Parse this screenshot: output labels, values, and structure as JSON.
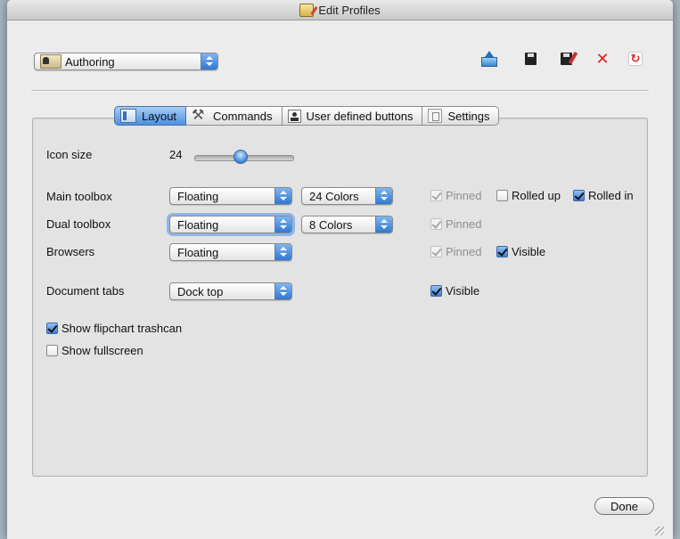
{
  "window": {
    "title": "Edit Profiles"
  },
  "profile": {
    "selected": "Authoring"
  },
  "toolbar": {
    "icons": [
      "export-icon",
      "save-icon",
      "save-as-icon",
      "delete-icon",
      "reload-icon"
    ],
    "delete_glyph": "✕",
    "reload_glyph": "↻"
  },
  "tabs": [
    {
      "label": "Layout",
      "icon": "layout-icon",
      "active": true
    },
    {
      "label": "Commands",
      "icon": "tools-icon",
      "active": false
    },
    {
      "label": "User defined buttons",
      "icon": "user-icon",
      "active": false
    },
    {
      "label": "Settings",
      "icon": "settings-icon",
      "active": false
    }
  ],
  "layout": {
    "icon_size": {
      "label": "Icon size",
      "value": "24"
    },
    "main_toolbox": {
      "label": "Main toolbox",
      "mode": "Floating",
      "colors": "24 Colors",
      "pinned": {
        "label": "Pinned",
        "checked": true,
        "enabled": false
      },
      "rolled_up": {
        "label": "Rolled up",
        "checked": false,
        "enabled": true
      },
      "rolled_in": {
        "label": "Rolled in",
        "checked": true,
        "enabled": true
      }
    },
    "dual_toolbox": {
      "label": "Dual toolbox",
      "mode": "Floating",
      "colors": "8 Colors",
      "pinned": {
        "label": "Pinned",
        "checked": true,
        "enabled": false
      }
    },
    "browsers": {
      "label": "Browsers",
      "mode": "Floating",
      "pinned": {
        "label": "Pinned",
        "checked": true,
        "enabled": false
      },
      "visible": {
        "label": "Visible",
        "checked": true,
        "enabled": true
      }
    },
    "document_tabs": {
      "label": "Document tabs",
      "position": "Dock top",
      "visible": {
        "label": "Visible",
        "checked": true,
        "enabled": true
      }
    },
    "show_flipchart_trashcan": {
      "label": "Show flipchart trashcan",
      "checked": true
    },
    "show_fullscreen": {
      "label": "Show fullscreen",
      "checked": false
    }
  },
  "footer": {
    "done_label": "Done"
  },
  "colors": {
    "accent": "#3b82d8",
    "window_bg": "#ececec",
    "desktop_bg": "#a7b8c4"
  }
}
